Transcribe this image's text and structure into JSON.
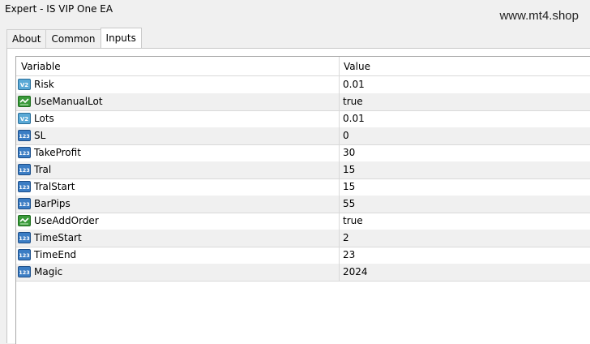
{
  "window": {
    "title": "Expert - IS VIP One EA"
  },
  "watermark": "www.mt4.shop",
  "tabs": [
    {
      "label": "About",
      "active": false
    },
    {
      "label": "Common",
      "active": false
    },
    {
      "label": "Inputs",
      "active": true
    }
  ],
  "table": {
    "columns": [
      "Variable",
      "Value"
    ],
    "rows": [
      {
        "variable": "Risk",
        "value": "0.01",
        "icon": "double-value-icon"
      },
      {
        "variable": "UseManualLot",
        "value": "true",
        "icon": "bool-value-icon"
      },
      {
        "variable": "Lots",
        "value": "0.01",
        "icon": "double-value-icon"
      },
      {
        "variable": "SL",
        "value": "0",
        "icon": "int-value-icon"
      },
      {
        "variable": "TakeProfit",
        "value": "30",
        "icon": "int-value-icon"
      },
      {
        "variable": "Tral",
        "value": "15",
        "icon": "int-value-icon"
      },
      {
        "variable": "TralStart",
        "value": "15",
        "icon": "int-value-icon"
      },
      {
        "variable": "BarPips",
        "value": "55",
        "icon": "int-value-icon"
      },
      {
        "variable": "UseAddOrder",
        "value": "true",
        "icon": "bool-value-icon"
      },
      {
        "variable": "TimeStart",
        "value": "2",
        "icon": "int-value-icon"
      },
      {
        "variable": "TimeEnd",
        "value": "23",
        "icon": "int-value-icon"
      },
      {
        "variable": "Magic",
        "value": "2024",
        "icon": "int-value-icon"
      }
    ]
  }
}
